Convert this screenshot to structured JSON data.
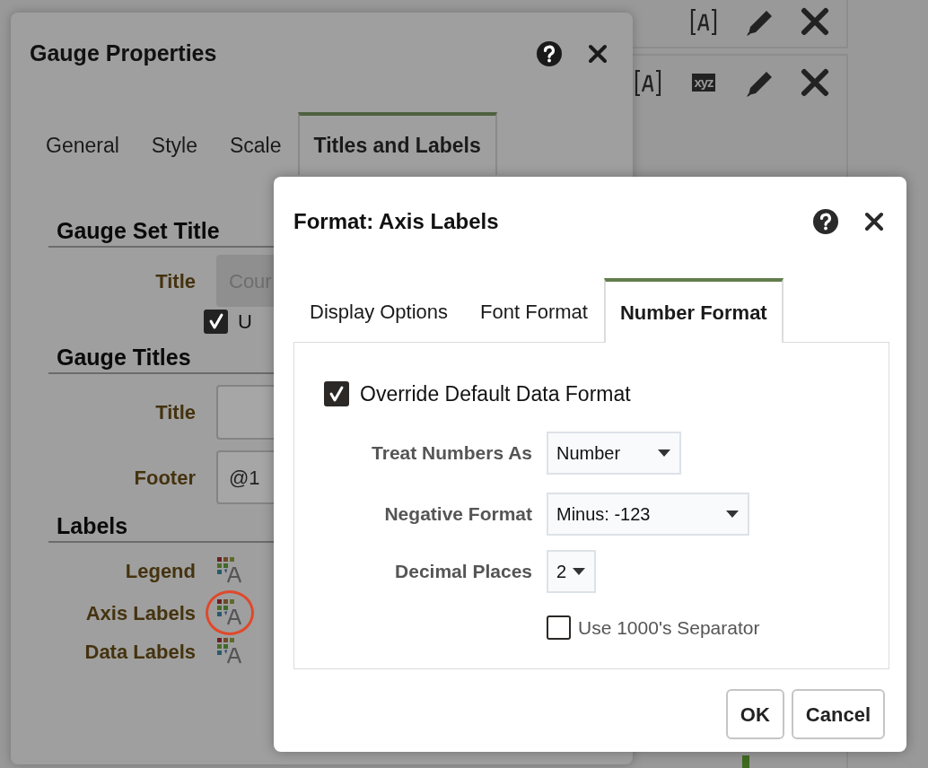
{
  "background_panels": [
    {
      "tools": [
        {
          "kind": "text-format"
        },
        {
          "kind": "edit"
        },
        {
          "kind": "delete"
        }
      ]
    },
    {
      "tools": [
        {
          "kind": "text-format"
        },
        {
          "kind": "text-sample",
          "label": "xyz"
        },
        {
          "kind": "edit"
        },
        {
          "kind": "delete"
        }
      ]
    }
  ],
  "gauge_dialog": {
    "title": "Gauge Properties",
    "tabs": [
      {
        "label": "General",
        "selected": false
      },
      {
        "label": "Style",
        "selected": false
      },
      {
        "label": "Scale",
        "selected": false
      },
      {
        "label": "Titles and Labels",
        "selected": true
      }
    ],
    "sections": [
      {
        "heading": "Gauge Set Title",
        "rows": [
          {
            "kind": "field",
            "label": "Title",
            "placeholder": "Cour",
            "disabled": true
          },
          {
            "kind": "checkbox",
            "label": "U",
            "checked": true
          }
        ]
      },
      {
        "heading": "Gauge Titles",
        "rows": [
          {
            "kind": "field",
            "label": "Title",
            "disabled": false
          },
          {
            "kind": "field",
            "label": "Footer",
            "value": "@1",
            "disabled": false
          }
        ]
      },
      {
        "heading": "Labels",
        "rows": [
          {
            "kind": "format",
            "label": "Legend",
            "highlighted": false
          },
          {
            "kind": "format",
            "label": "Axis Labels",
            "highlighted": true
          },
          {
            "kind": "format",
            "label": "Data Labels",
            "highlighted": false
          }
        ]
      }
    ]
  },
  "format_dialog": {
    "title": "Format: Axis Labels",
    "tabs": [
      {
        "label": "Display Options",
        "selected": false
      },
      {
        "label": "Font Format",
        "selected": false
      },
      {
        "label": "Number Format",
        "selected": true
      }
    ],
    "override": {
      "label": "Override Default Data Format",
      "checked": true
    },
    "fields": [
      {
        "label": "Treat Numbers As",
        "value": "Number"
      },
      {
        "label": "Negative Format",
        "value": "Minus: -123"
      },
      {
        "label": "Decimal Places",
        "value": "2"
      }
    ],
    "separator": {
      "label": "Use 1000's Separator",
      "checked": false
    },
    "buttons": [
      {
        "label": "OK"
      },
      {
        "label": "Cancel"
      }
    ]
  }
}
